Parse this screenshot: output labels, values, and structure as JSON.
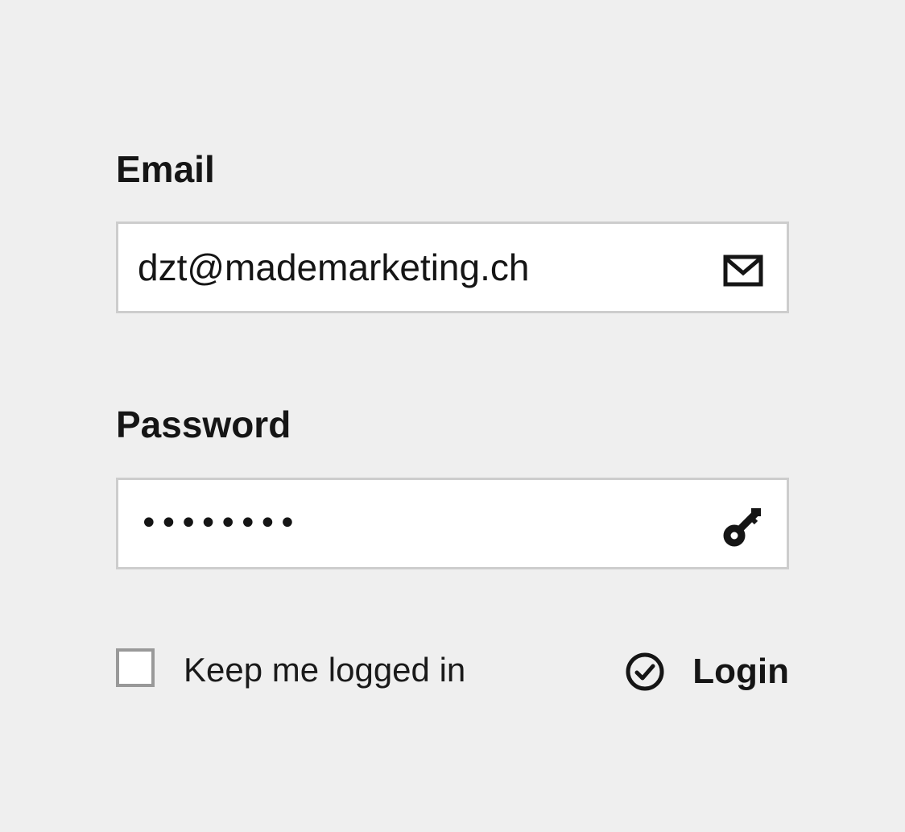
{
  "form": {
    "email": {
      "label": "Email",
      "value": "dzt@mademarketing.ch",
      "icon": "envelope-icon"
    },
    "password": {
      "label": "Password",
      "masked_value": "••••••••",
      "icon": "key-icon"
    },
    "keep_logged_in": {
      "label": "Keep me logged in",
      "checked": false
    },
    "login": {
      "label": "Login",
      "icon": "check-circle-icon"
    }
  },
  "colors": {
    "background": "#efefef",
    "field_background": "#ffffff",
    "field_border": "#cdcdcd",
    "checkbox_border": "#999999",
    "text": "#151515"
  }
}
